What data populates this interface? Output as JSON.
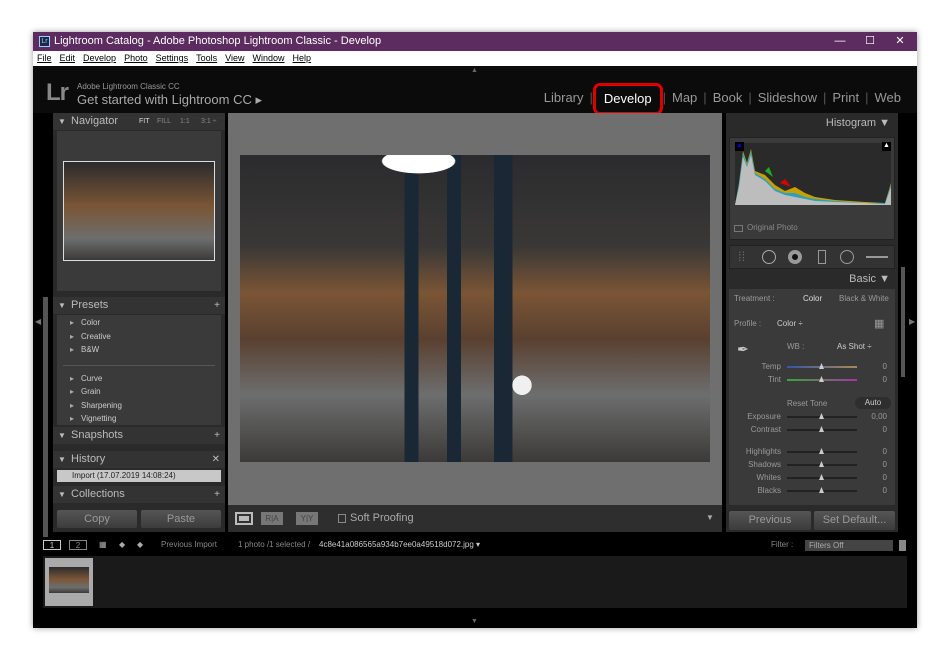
{
  "window": {
    "title": "Lightroom Catalog - Adobe Photoshop Lightroom Classic - Develop",
    "app_icon": "Lr",
    "controls": [
      "minimize-icon",
      "maximize-icon",
      "close-icon"
    ]
  },
  "menu": [
    "File",
    "Edit",
    "Develop",
    "Photo",
    "Settings",
    "Tools",
    "View",
    "Window",
    "Help"
  ],
  "identity": {
    "logo": "Lr",
    "product": "Adobe Lightroom Classic CC",
    "tagline": "Get started with Lightroom CC ▸"
  },
  "modules": [
    {
      "label": "Library"
    },
    {
      "label": "Develop",
      "active": true
    },
    {
      "label": "Map"
    },
    {
      "label": "Book"
    },
    {
      "label": "Slideshow"
    },
    {
      "label": "Print"
    },
    {
      "label": "Web"
    }
  ],
  "highlight_color": "#e00000",
  "navigator": {
    "title": "Navigator",
    "zoom": [
      "FIT",
      "FILL",
      "1:1",
      "3:1 ÷"
    ]
  },
  "presets": {
    "title": "Presets",
    "groups1": [
      "Color",
      "Creative",
      "B&W"
    ],
    "groups2": [
      "Curve",
      "Grain",
      "Sharpening",
      "Vignetting"
    ]
  },
  "snapshots": {
    "title": "Snapshots"
  },
  "history": {
    "title": "History",
    "items": [
      "Import (17.07.2019 14:08:24)"
    ]
  },
  "collections": {
    "title": "Collections"
  },
  "left_buttons": {
    "copy": "Copy",
    "paste": "Paste"
  },
  "toolbar": {
    "soft_proofing": "Soft Proofing",
    "view_ra": "R|A",
    "view_yy": "Y|Y"
  },
  "histogram": {
    "title": "Histogram",
    "original_photo": "Original Photo"
  },
  "basic": {
    "title": "Basic",
    "treatment_label": "Treatment :",
    "treatment_color": "Color",
    "treatment_bw": "Black & White",
    "profile_label": "Profile :",
    "profile_value": "Color ÷",
    "wb_label": "WB :",
    "wb_value": "As Shot ÷",
    "reset_tone": "Reset Tone",
    "auto": "Auto",
    "sliders": [
      {
        "label": "Temp",
        "value": "0"
      },
      {
        "label": "Tint",
        "value": "0"
      },
      {
        "label": "Exposure",
        "value": "0,00"
      },
      {
        "label": "Contrast",
        "value": "0"
      },
      {
        "label": "Highlights",
        "value": "0"
      },
      {
        "label": "Shadows",
        "value": "0"
      },
      {
        "label": "Whites",
        "value": "0"
      },
      {
        "label": "Blacks",
        "value": "0"
      }
    ]
  },
  "right_buttons": {
    "previous": "Previous",
    "set_default": "Set Default..."
  },
  "filmstrip": {
    "screen1": "1",
    "screen2": "2",
    "source": "Previous Import",
    "count": "1 photo /1 selected /",
    "filename": "4c8e41a086565a934b7ee0a49518d072.jpg ▾",
    "filter_label": "Filter :",
    "filter_value": "Filters Off"
  }
}
